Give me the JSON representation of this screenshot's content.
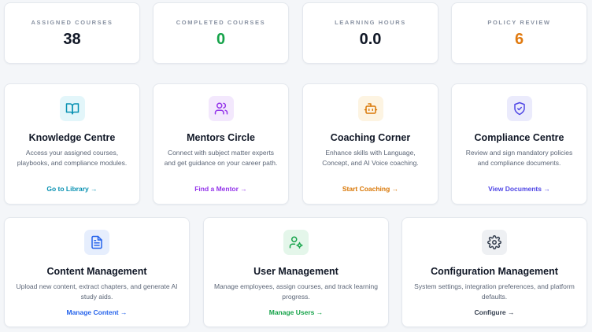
{
  "stats": [
    {
      "label": "ASSIGNED COURSES",
      "value": "38",
      "color": "#101726"
    },
    {
      "label": "COMPLETED COURSES",
      "value": "0",
      "color": "#16a34a"
    },
    {
      "label": "LEARNING HOURS",
      "value": "0.0",
      "color": "#101726"
    },
    {
      "label": "POLICY REVIEW",
      "value": "6",
      "color": "#e07a10"
    }
  ],
  "modules": [
    {
      "title": "Knowledge Centre",
      "description": "Access your assigned courses, playbooks, and compliance modules.",
      "link": "Go to Library →",
      "icon": "book-open-icon",
      "accent": "#0891b2",
      "icon_bg": "#e3f6fa"
    },
    {
      "title": "Mentors Circle",
      "description": "Connect with subject matter experts and get guidance on your career path.",
      "link": "Find a Mentor →",
      "icon": "users-icon",
      "accent": "#9333ea",
      "icon_bg": "#f3e8fd"
    },
    {
      "title": "Coaching Corner",
      "description": "Enhance skills with Language, Concept, and AI Voice coaching.",
      "link": "Start Coaching →",
      "icon": "bot-icon",
      "accent": "#d97706",
      "icon_bg": "#fdf4e2"
    },
    {
      "title": "Compliance Centre",
      "description": "Review and sign mandatory policies and compliance documents.",
      "link": "View Documents →",
      "icon": "shield-check-icon",
      "accent": "#4f46e5",
      "icon_bg": "#ebebfc"
    },
    {
      "title": "Content Management",
      "description": "Upload new content, extract chapters, and generate AI study aids.",
      "link": "Manage Content →",
      "icon": "file-text-icon",
      "accent": "#2563eb",
      "icon_bg": "#e6eefd"
    },
    {
      "title": "User Management",
      "description": "Manage employees, assign courses, and track learning progress.",
      "link": "Manage Users →",
      "icon": "user-cog-icon",
      "accent": "#16a34a",
      "icon_bg": "#e4f6ea"
    },
    {
      "title": "Configuration Management",
      "description": "System settings, integration preferences, and platform defaults.",
      "link": "Configure →",
      "icon": "gear-icon",
      "accent": "#374151",
      "icon_bg": "#eef0f3"
    }
  ]
}
